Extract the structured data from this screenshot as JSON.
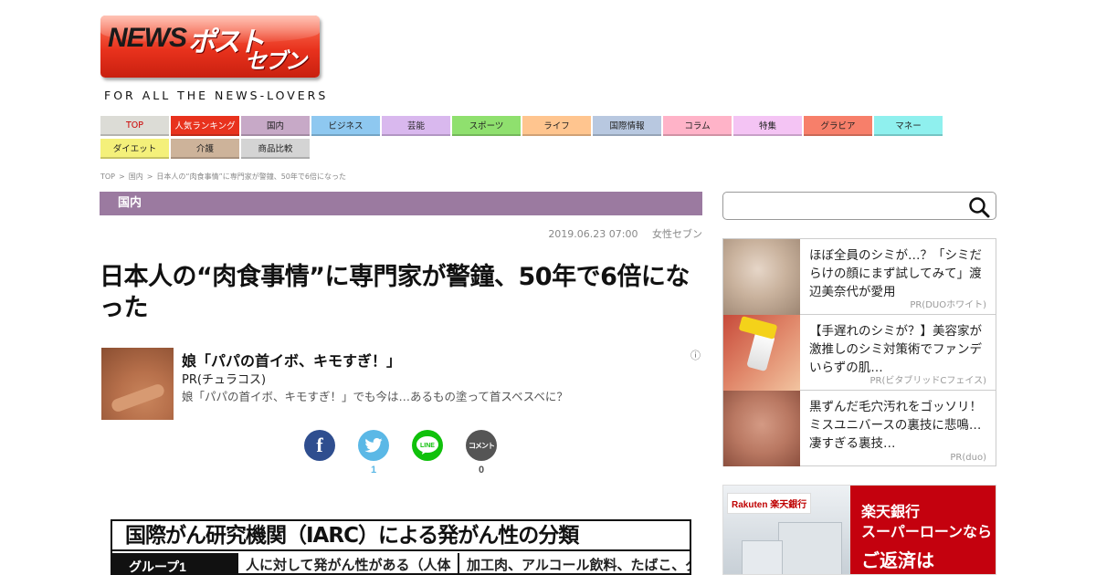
{
  "logo": {
    "news": "NEWS",
    "post": "ポスト",
    "seven": "セブン",
    "tagline": "FOR ALL THE NEWS-LOVERS"
  },
  "nav": [
    {
      "label": "TOP",
      "color": "#dcdcd6",
      "text_color": "#cc0000"
    },
    {
      "label": "人気ランキング",
      "color": "#e8321d",
      "text_color": "#ffffff"
    },
    {
      "label": "国内",
      "color": "#c7a9c7",
      "text_color": "#222222"
    },
    {
      "label": "ビジネス",
      "color": "#8ec8f0",
      "text_color": "#222222"
    },
    {
      "label": "芸能",
      "color": "#d9b8ee",
      "text_color": "#222222"
    },
    {
      "label": "スポーツ",
      "color": "#8fe06e",
      "text_color": "#222222"
    },
    {
      "label": "ライフ",
      "color": "#ffc58f",
      "text_color": "#222222"
    },
    {
      "label": "国際情報",
      "color": "#b8c8e0",
      "text_color": "#222222"
    },
    {
      "label": "コラム",
      "color": "#ffb3c8",
      "text_color": "#222222"
    },
    {
      "label": "特集",
      "color": "#f4c4f4",
      "text_color": "#222222"
    },
    {
      "label": "グラビア",
      "color": "#f77f6a",
      "text_color": "#222222"
    },
    {
      "label": "マネー",
      "color": "#8ff0ee",
      "text_color": "#222222"
    },
    {
      "label": "ダイエット",
      "color": "#f4f07a",
      "text_color": "#222222"
    },
    {
      "label": "介護",
      "color": "#cdb39a",
      "text_color": "#222222"
    },
    {
      "label": "商品比較",
      "color": "#d4d4d4",
      "text_color": "#222222"
    }
  ],
  "breadcrumb": [
    "TOP",
    ">",
    "国内",
    ">",
    "日本人の“肉食事情”に専門家が警鐘、50年で6倍になった"
  ],
  "category": "国内",
  "meta": {
    "date": "2019.06.23 07:00",
    "source": "女性セブン"
  },
  "title": "日本人の“肉食事情”に専門家が警鐘、50年で6倍になった",
  "ad": {
    "headline": "娘「パパの首イボ、キモすぎ！」",
    "sponsor": "PR(チュラコス)",
    "description": "娘「パパの首イボ、キモすぎ！」でも今は…あるもの塗って首スベスベに？",
    "info": "ⓘ"
  },
  "share": [
    {
      "name": "facebook",
      "glyph": "f",
      "color": "#2f4e8f",
      "count": ""
    },
    {
      "name": "twitter",
      "glyph": "🐦",
      "color": "#5bb8e6",
      "count": "1",
      "count_color": "#5bb8e6"
    },
    {
      "name": "line",
      "glyph": "LINE",
      "color": "#10c10b",
      "count": ""
    },
    {
      "name": "comment",
      "glyph": "コメント",
      "color": "#555555",
      "count": "0",
      "count_color": "#555555"
    }
  ],
  "article_image": {
    "heading": "国際がん研究機関（IARC）による発がん性の分類",
    "group": "グループ1",
    "col2": "人に対して発がん性がある（人体",
    "col3": "加工肉、アルコール飲料、たばこ、ダ"
  },
  "search": {
    "placeholder": ""
  },
  "side_ads": [
    {
      "text": "ほぼ全員のシミが…？「シミだらけの顔にまず試してみて」渡辺美奈代が愛用",
      "pr": "PR(DUOホワイト)"
    },
    {
      "text": "【手遅れのシミが？】美容家が激推しのシミ対策術でファンデいらずの肌…",
      "pr": "PR(ビタブリッドCフェイス)"
    },
    {
      "text": "黒ずんだ毛穴汚れをゴッソリ！ミスユニバースの裏技に悲鳴…凄すぎる裏技…",
      "pr": "PR(duo)"
    }
  ],
  "banner": {
    "brand_en": "Rakuten",
    "brand_jp": "楽天銀行",
    "line1": "楽天銀行",
    "line2": "スーパーローンなら",
    "line3": "ご返済は"
  }
}
